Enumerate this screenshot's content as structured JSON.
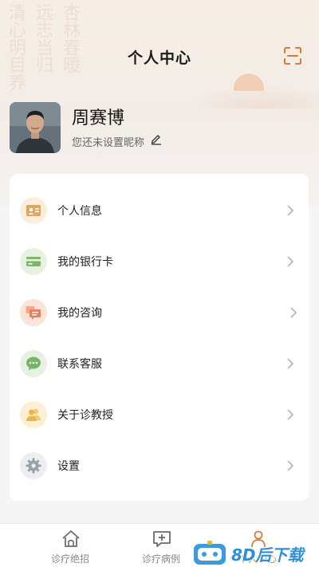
{
  "header": {
    "title": "个人中心"
  },
  "profile": {
    "name": "周赛博",
    "nickname_prompt": "您还未设置昵称"
  },
  "menu": {
    "items": [
      {
        "label": "个人信息",
        "icon": "id-card-icon",
        "color": "#e2a55a",
        "bg": "#fbeedd"
      },
      {
        "label": "我的银行卡",
        "icon": "bank-card-icon",
        "color": "#7fb56a",
        "bg": "#e7f1e0"
      },
      {
        "label": "我的咨询",
        "icon": "consult-icon",
        "color": "#e4825f",
        "bg": "#fbe3d9"
      },
      {
        "label": "联系客服",
        "icon": "chat-icon",
        "color": "#78b468",
        "bg": "#e6f1e1"
      },
      {
        "label": "关于诊教授",
        "icon": "people-icon",
        "color": "#e8b64b",
        "bg": "#fcefd2"
      },
      {
        "label": "设置",
        "icon": "gear-icon",
        "color": "#9aa0aa",
        "bg": "#eceef1"
      }
    ]
  },
  "tabbar": {
    "tabs": [
      {
        "label": "诊疗绝招",
        "icon": "home-icon",
        "active": false
      },
      {
        "label": "诊疗病例",
        "icon": "case-icon",
        "active": false
      },
      {
        "label": "个人中心",
        "icon": "profile-icon",
        "active": true
      }
    ]
  },
  "watermark": {
    "text": "8D后下载"
  },
  "colors": {
    "accent": "#e07a3f",
    "background": "#f5f5f5",
    "card": "#ffffff"
  }
}
